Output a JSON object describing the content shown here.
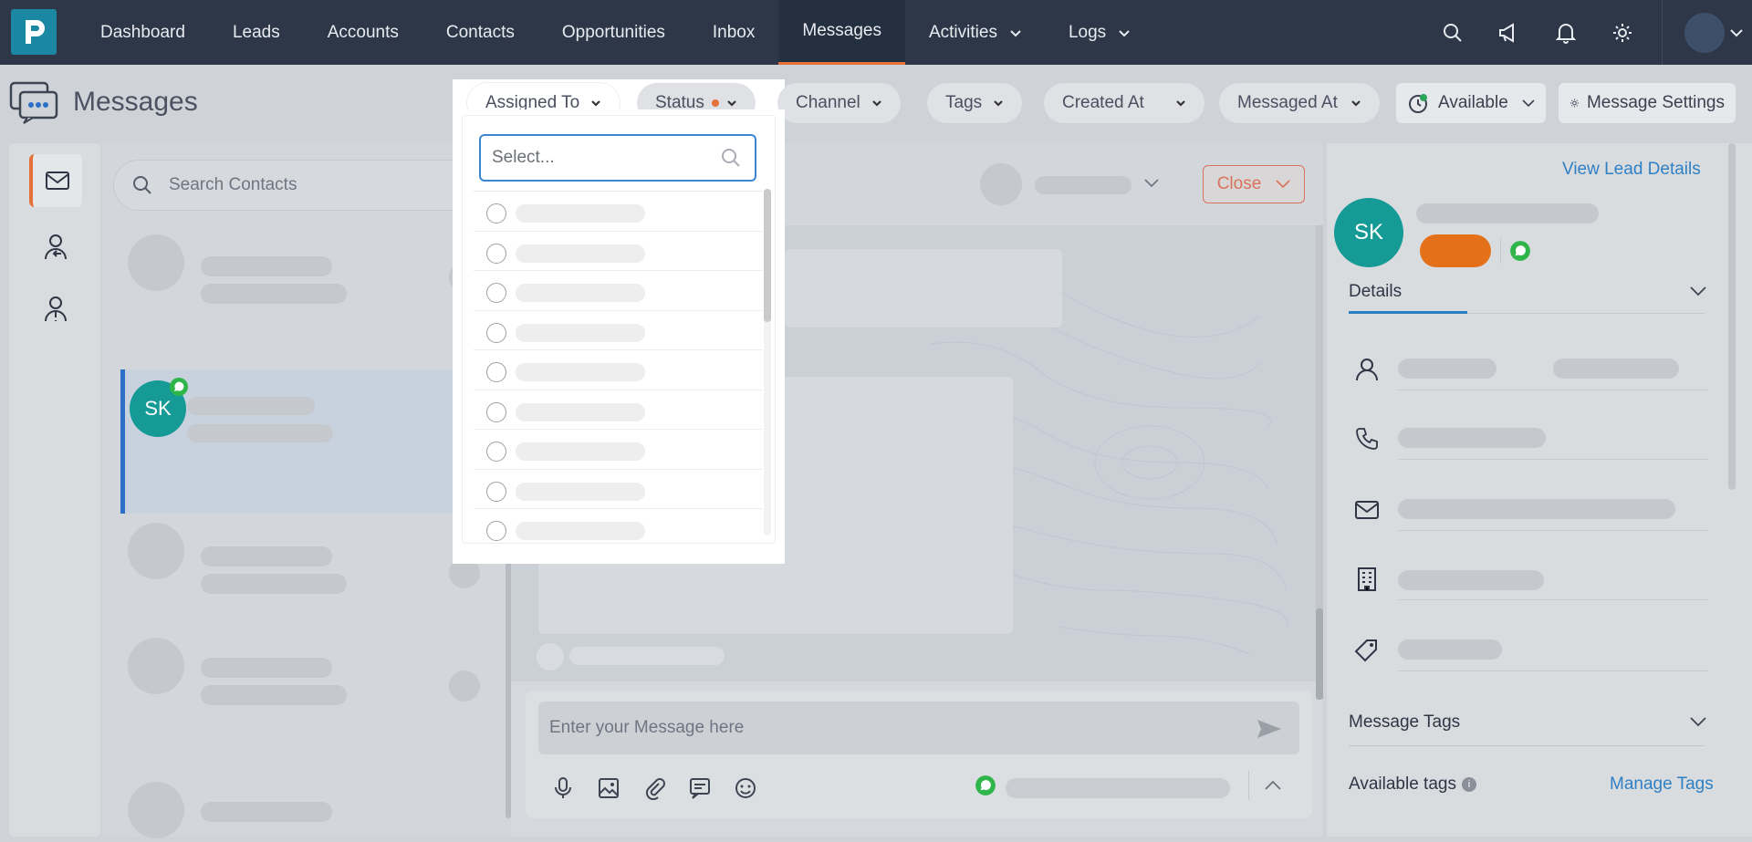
{
  "nav": {
    "items": [
      {
        "label": "Dashboard"
      },
      {
        "label": "Leads"
      },
      {
        "label": "Accounts"
      },
      {
        "label": "Contacts"
      },
      {
        "label": "Opportunities"
      },
      {
        "label": "Inbox"
      },
      {
        "label": "Messages"
      },
      {
        "label": "Activities"
      },
      {
        "label": "Logs"
      }
    ],
    "active": "Messages"
  },
  "page": {
    "title": "Messages"
  },
  "filters": {
    "assigned_to": "Assigned To",
    "status": "Status",
    "channel": "Channel",
    "tags": "Tags",
    "created_at": "Created At",
    "messaged_at": "Messaged At"
  },
  "availability": {
    "label": "Available"
  },
  "message_settings": {
    "label": "Message Settings"
  },
  "contacts": {
    "search_placeholder": "Search Contacts",
    "active_initials": "SK"
  },
  "chat": {
    "close_label": "Close",
    "composer_placeholder": "Enter your Message here"
  },
  "right_panel": {
    "view_lead_details": "View Lead Details",
    "initials": "SK",
    "details_tab": "Details",
    "message_tags": "Message Tags",
    "available_tags": "Available tags",
    "manage_tags": "Manage Tags"
  },
  "dropdown": {
    "search_placeholder": "Select..."
  },
  "colors": {
    "accent_orange": "#e5703a",
    "nav_bg": "#2d3748",
    "link_blue": "#2f7fc4",
    "avatar_teal": "#169a96"
  }
}
